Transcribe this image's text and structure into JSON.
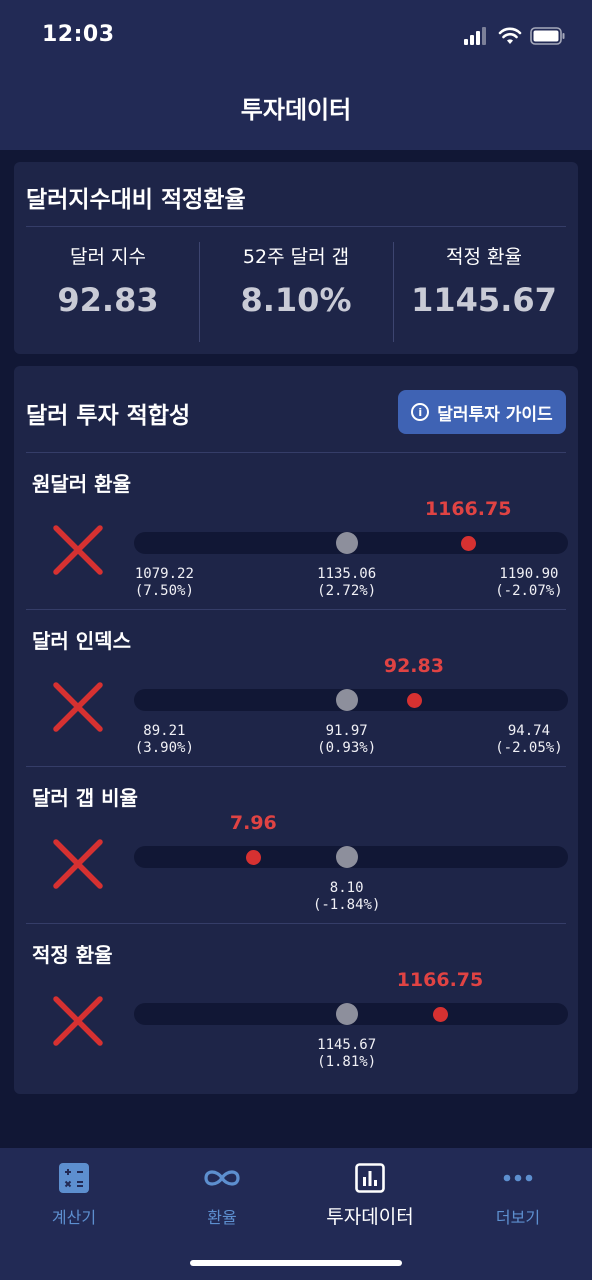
{
  "status_bar": {
    "time": "12:03"
  },
  "header": {
    "title": "투자데이터"
  },
  "fair_rate_card": {
    "title": "달러지수대비 적정환율",
    "metrics": [
      {
        "label": "달러 지수",
        "value": "92.83"
      },
      {
        "label": "52주 달러 갭",
        "value": "8.10%"
      },
      {
        "label": "적정 환율",
        "value": "1145.67"
      }
    ]
  },
  "fitness_card": {
    "title": "달러 투자 적합성",
    "guide_button": "달러투자 가이드",
    "rows": [
      {
        "label": "원달러 환율",
        "current": "1166.75",
        "current_position": 0.77,
        "reference_position": 0.49,
        "ticks": [
          {
            "value": "1079.22",
            "pct": "(7.50%)"
          },
          {
            "value": "1135.06",
            "pct": "(2.72%)"
          },
          {
            "value": "1190.90",
            "pct": "(-2.07%)"
          }
        ]
      },
      {
        "label": "달러 인덱스",
        "current": "92.83",
        "current_position": 0.645,
        "reference_position": 0.49,
        "ticks": [
          {
            "value": "89.21",
            "pct": "(3.90%)"
          },
          {
            "value": "91.97",
            "pct": "(0.93%)"
          },
          {
            "value": "94.74",
            "pct": "(-2.05%)"
          }
        ]
      },
      {
        "label": "달러 갭 비율",
        "current": "7.96",
        "current_position": 0.275,
        "reference_position": 0.49,
        "ticks": [
          {
            "value": "8.10",
            "pct": "(-1.84%)"
          }
        ]
      },
      {
        "label": "적정 환율",
        "current": "1166.75",
        "current_position": 0.705,
        "reference_position": 0.49,
        "ticks": [
          {
            "value": "1145.67",
            "pct": "(1.81%)"
          }
        ]
      }
    ]
  },
  "tab_bar": {
    "tabs": [
      {
        "label": "계산기",
        "icon": "calculator-icon",
        "active": false
      },
      {
        "label": "환율",
        "icon": "infinity-icon",
        "active": false
      },
      {
        "label": "투자데이터",
        "icon": "bar-chart-icon",
        "active": true
      },
      {
        "label": "더보기",
        "icon": "more-dots-icon",
        "active": false
      }
    ]
  },
  "colors": {
    "background": "#111735",
    "header": "#222a55",
    "card": "#1e2548",
    "accent_red": "#d63131",
    "button_blue": "#3f63b4",
    "tab_inactive": "#5d8fcf"
  }
}
